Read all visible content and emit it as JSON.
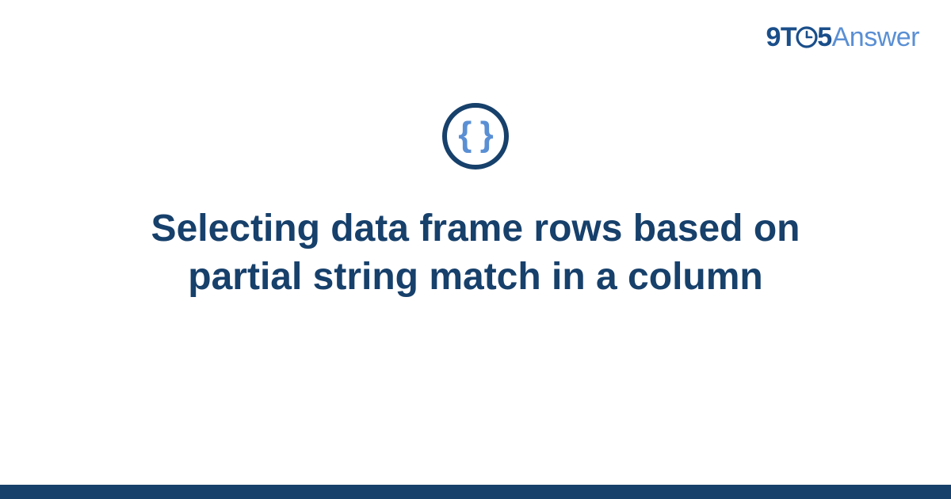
{
  "brand": {
    "part_nine": "9",
    "part_t": "T",
    "part_five": "5",
    "part_answer": "Answer"
  },
  "icon": {
    "glyph": "{ }",
    "name": "code-braces-icon"
  },
  "title": "Selecting data frame rows based on partial string match in a column",
  "colors": {
    "primary_dark": "#17406b",
    "primary_light": "#5a8fd4"
  }
}
